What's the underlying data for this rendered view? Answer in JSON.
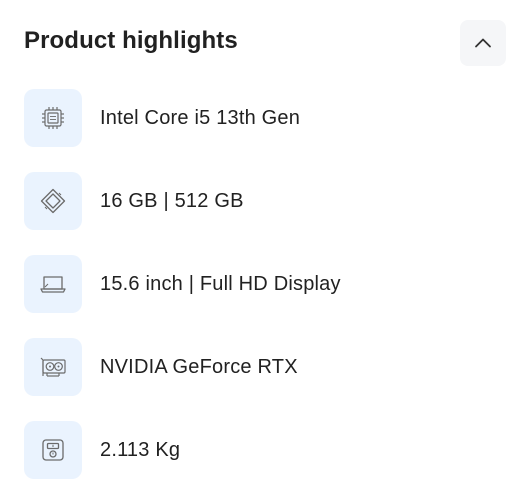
{
  "section": {
    "title": "Product highlights",
    "collapse_icon": "chevron-up-icon"
  },
  "highlights": [
    {
      "icon": "cpu-icon",
      "label": "Intel Core i5 13th Gen"
    },
    {
      "icon": "memory-storage-icon",
      "label": "16 GB | 512 GB"
    },
    {
      "icon": "laptop-display-icon",
      "label": "15.6 inch | Full HD Display"
    },
    {
      "icon": "graphics-card-icon",
      "label": "NVIDIA GeForce RTX"
    },
    {
      "icon": "weight-scale-icon",
      "label": "2.113 Kg"
    }
  ],
  "colors": {
    "icon_background": "#eaf3fe",
    "button_background": "#f5f6f8",
    "text": "#212121",
    "icon_stroke": "#6b6b6b"
  }
}
